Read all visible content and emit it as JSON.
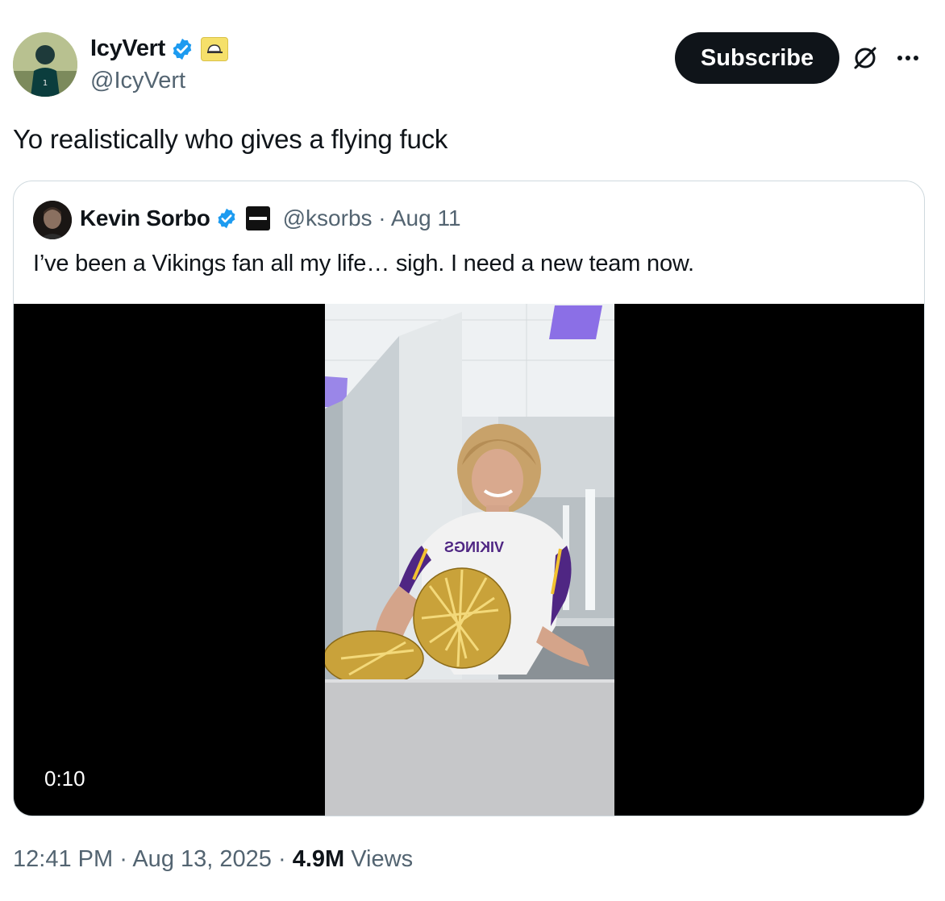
{
  "tweet": {
    "author": {
      "display_name": "IcyVert",
      "handle": "@IcyVert",
      "verified": true,
      "affiliate_icon": "cap-icon"
    },
    "subscribe_label": "Subscribe",
    "text": "Yo realistically who gives a flying fuck",
    "timestamp": "12:41 PM",
    "date": "Aug 13, 2025",
    "views_count": "4.9M",
    "views_label": "Views",
    "separator": "·"
  },
  "quoted": {
    "display_name": "Kevin Sorbo",
    "verified": true,
    "affiliate_icon": "outlet-logo-icon",
    "handle_date": "@ksorbs · Aug 11",
    "text": "I’ve been a Vikings fan all my life… sigh. I need a new team now.",
    "video": {
      "duration": "0:10",
      "jersey_text": "VIKINGS"
    }
  },
  "colors": {
    "accent_blue": "#1d9bf0",
    "text_primary": "#0f1419",
    "text_secondary": "#536471",
    "border": "#cfd9de",
    "vikings_purple": "#4f2683"
  }
}
